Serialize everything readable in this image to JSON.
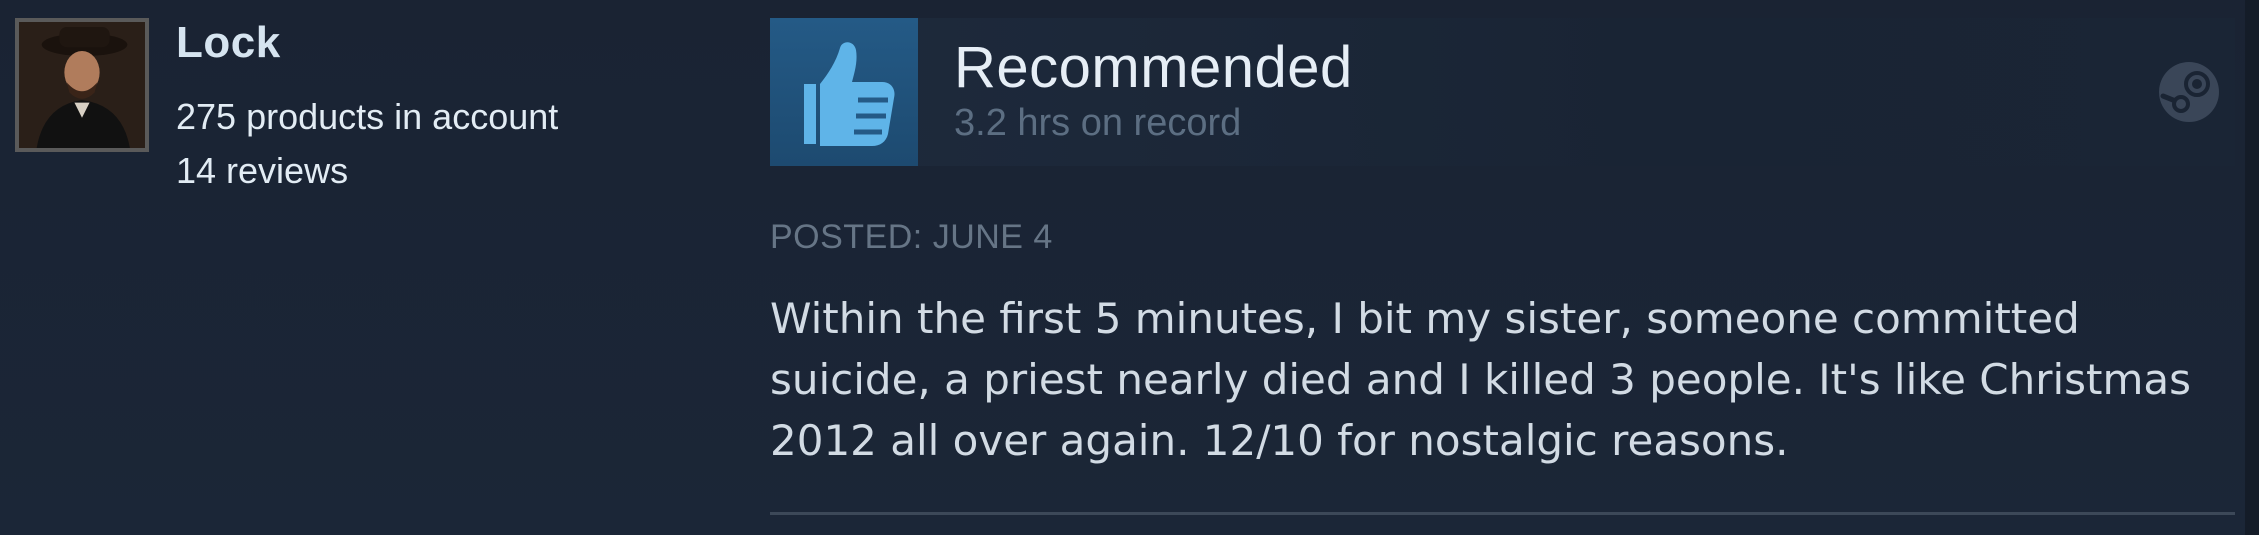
{
  "author": {
    "name": "Lock",
    "products": "275 products in account",
    "reviews": "14 reviews"
  },
  "review": {
    "verdict": "Recommended",
    "hours": "3.2 hrs on record",
    "posted": "POSTED: JUNE 4",
    "text": "Within the first 5 minutes, I bit my sister, someone committed suicide, a priest nearly died and I killed 3 people. It's like Christmas 2012 all over again. 12/10 for nostalgic reasons."
  },
  "icons": {
    "verdict_icon": "thumbs-up-icon",
    "platform_icon": "steam-icon"
  },
  "colors": {
    "background": "#1b2535",
    "thumb_bg": "#245a86",
    "thumb_fg": "#5fb4e8",
    "title": "#e6eef6",
    "muted": "#5c6e82"
  }
}
